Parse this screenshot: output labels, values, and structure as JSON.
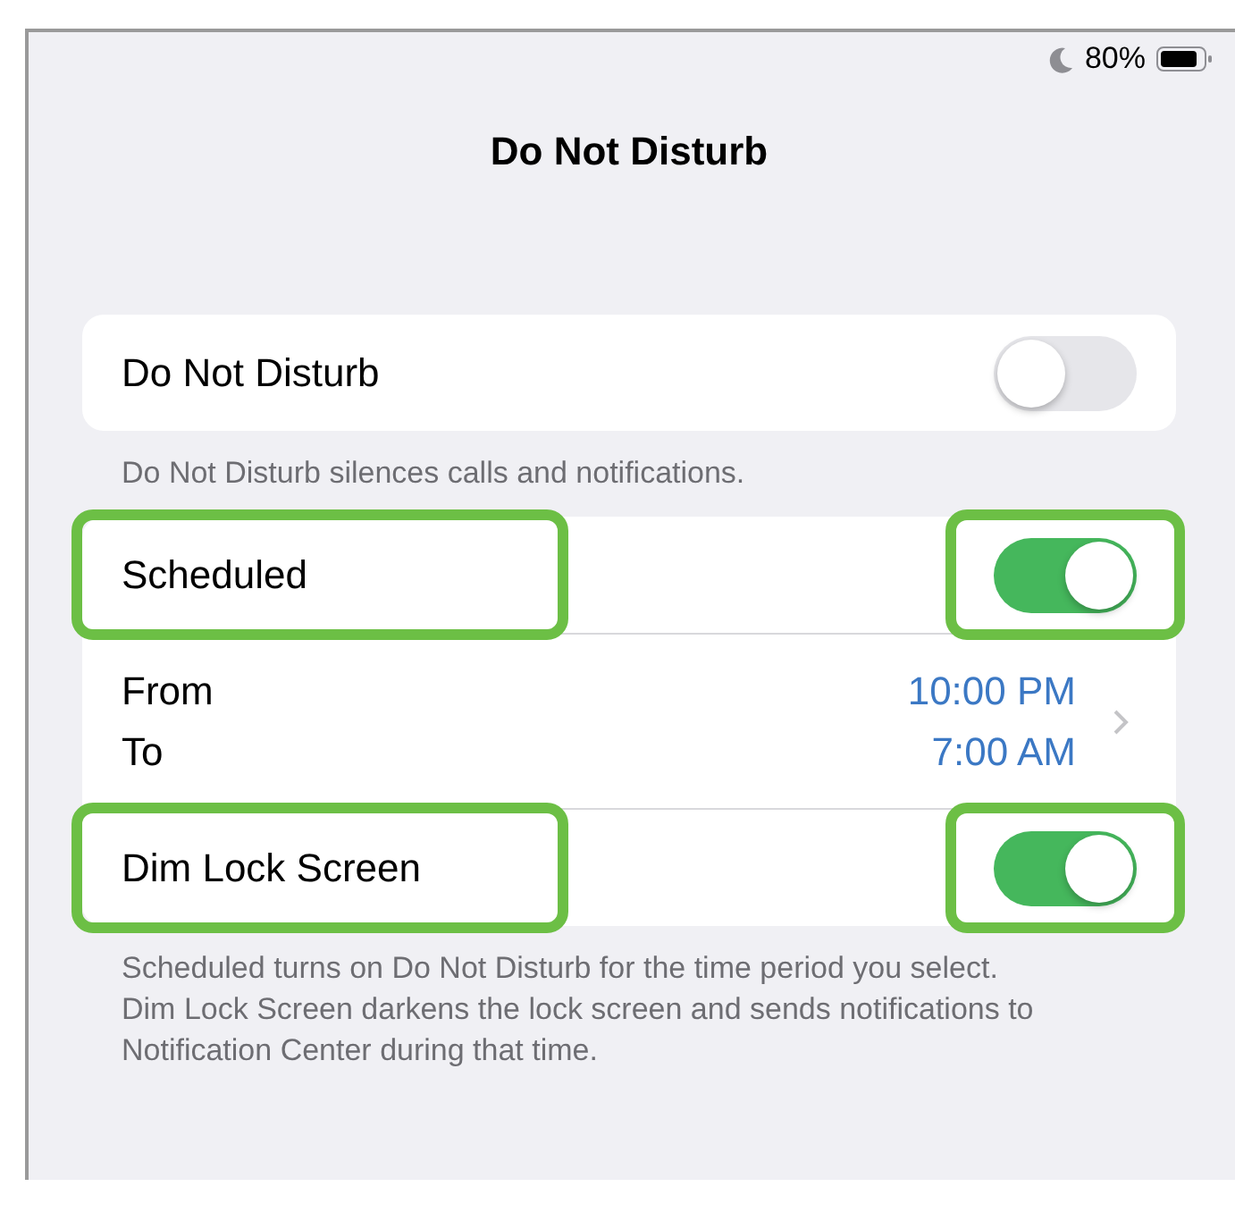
{
  "status_bar": {
    "do_not_disturb_on": true,
    "battery_text": "80%"
  },
  "title": "Do Not Disturb",
  "groups": [
    {
      "rows": [
        {
          "kind": "toggle",
          "label": "Do Not Disturb",
          "on": false,
          "label_highlighted": false,
          "toggle_highlighted": false
        }
      ],
      "footer": "Do Not Disturb silences calls and notifications."
    },
    {
      "rows": [
        {
          "kind": "toggle",
          "label": "Scheduled",
          "on": true,
          "label_highlighted": true,
          "toggle_highlighted": true
        },
        {
          "kind": "range",
          "from_label": "From",
          "to_label": "To",
          "from_value": "10:00 PM",
          "to_value": "7:00 AM"
        },
        {
          "kind": "toggle",
          "label": "Dim Lock Screen",
          "on": true,
          "label_highlighted": true,
          "toggle_highlighted": true
        }
      ],
      "footer": "Scheduled turns on Do Not Disturb for the time period you select. Dim Lock Screen darkens the lock screen and sends notifications to Notification Center during that time."
    }
  ]
}
